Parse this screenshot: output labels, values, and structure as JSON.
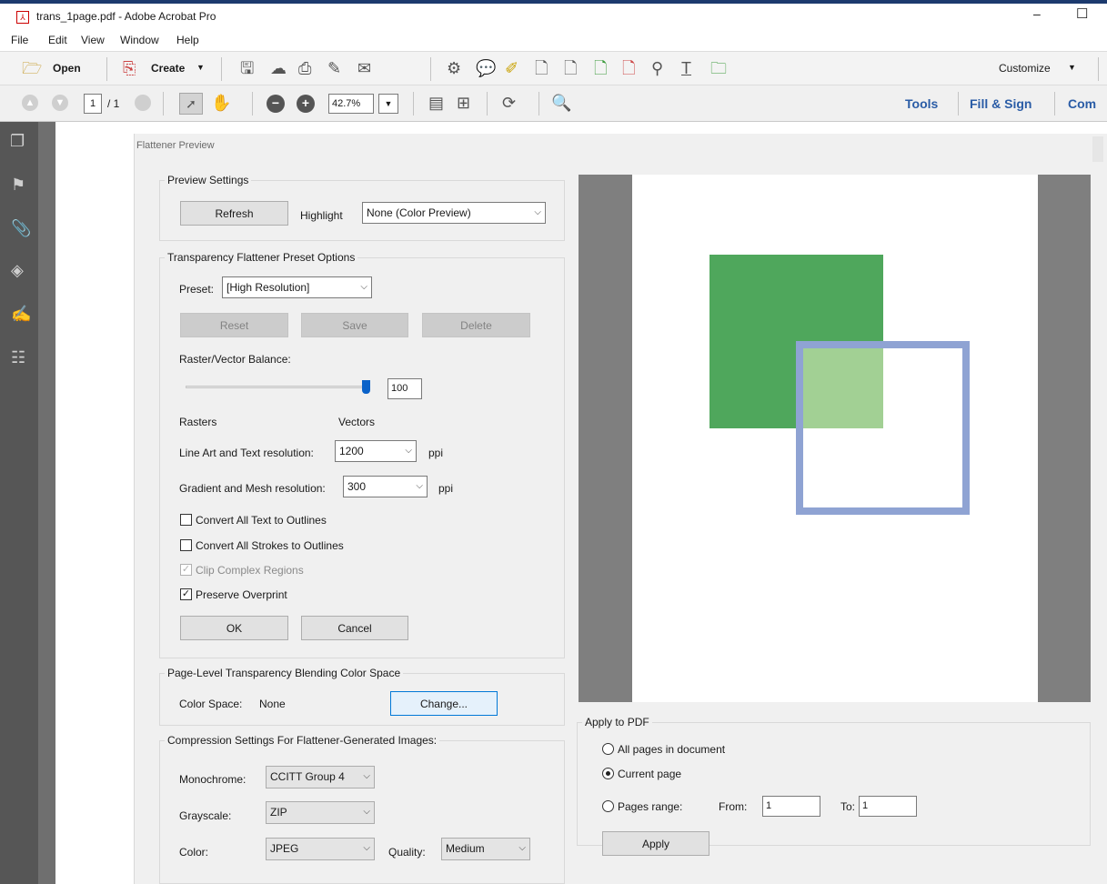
{
  "window": {
    "title": "trans_1page.pdf - Adobe Acrobat Pro",
    "minimize": "–",
    "maximize": "☐"
  },
  "menu": [
    "File",
    "Edit",
    "View",
    "Window",
    "Help"
  ],
  "toolbar": {
    "open_label": "Open",
    "create_label": "Create",
    "customize_label": "Customize"
  },
  "nav": {
    "page_current": "1",
    "page_total": "/ 1",
    "zoom": "42.7%",
    "tools": "Tools",
    "fill_sign": "Fill & Sign",
    "comment": "Com"
  },
  "dialog": {
    "title": "Flattener Preview",
    "preview_settings": {
      "legend": "Preview Settings",
      "refresh": "Refresh",
      "highlight_label": "Highlight",
      "highlight_value": "None (Color Preview)"
    },
    "preset_options": {
      "legend": "Transparency Flattener Preset Options",
      "preset_label": "Preset:",
      "preset_value": "[High Resolution]",
      "reset": "Reset",
      "save": "Save",
      "delete": "Delete",
      "balance_label": "Raster/Vector Balance:",
      "balance_value": "100",
      "balance_fraction": 1.0,
      "rasters": "Rasters",
      "vectors": "Vectors",
      "lineart_label": "Line Art and Text resolution:",
      "lineart_value": "1200",
      "lineart_unit": "ppi",
      "gradient_label": "Gradient and Mesh resolution:",
      "gradient_value": "300",
      "gradient_unit": "ppi",
      "convert_text": "Convert All Text to Outlines",
      "convert_strokes": "Convert All Strokes to Outlines",
      "clip_complex": "Clip Complex Regions",
      "preserve_overprint": "Preserve Overprint",
      "ok": "OK",
      "cancel": "Cancel"
    },
    "color_space": {
      "legend": "Page-Level Transparency Blending Color Space",
      "label": "Color Space:",
      "value": "None",
      "change": "Change..."
    },
    "compression": {
      "legend": "Compression Settings For Flattener-Generated Images:",
      "mono_label": "Monochrome:",
      "mono_value": "CCITT Group 4",
      "gray_label": "Grayscale:",
      "gray_value": "ZIP",
      "color_label": "Color:",
      "color_value": "JPEG",
      "quality_label": "Quality:",
      "quality_value": "Medium"
    },
    "apply": {
      "legend": "Apply to PDF",
      "all_pages": "All pages in document",
      "current_page": "Current page",
      "pages_range": "Pages range:",
      "from_label": "From:",
      "from_value": "1",
      "to_label": "To:",
      "to_value": "1",
      "apply_button": "Apply"
    }
  },
  "colors": {
    "accent": "#0078d7",
    "green_square": "#4fa75c",
    "blue_square": "#8fa3d3",
    "overlap": "#a2d094"
  },
  "icons": [
    "open-folder-icon",
    "create-pdf-icon",
    "save-icon",
    "cloud-upload-icon",
    "print-icon",
    "edit-icon",
    "email-icon",
    "settings-icon",
    "comment-icon",
    "stamp-icon",
    "hand-tool-icon",
    "select-tool-icon",
    "zoom-out-icon",
    "zoom-in-icon",
    "search-icon",
    "pages-icon",
    "bookmark-icon",
    "attachment-icon",
    "layers-icon",
    "signature-icon",
    "tags-icon"
  ]
}
